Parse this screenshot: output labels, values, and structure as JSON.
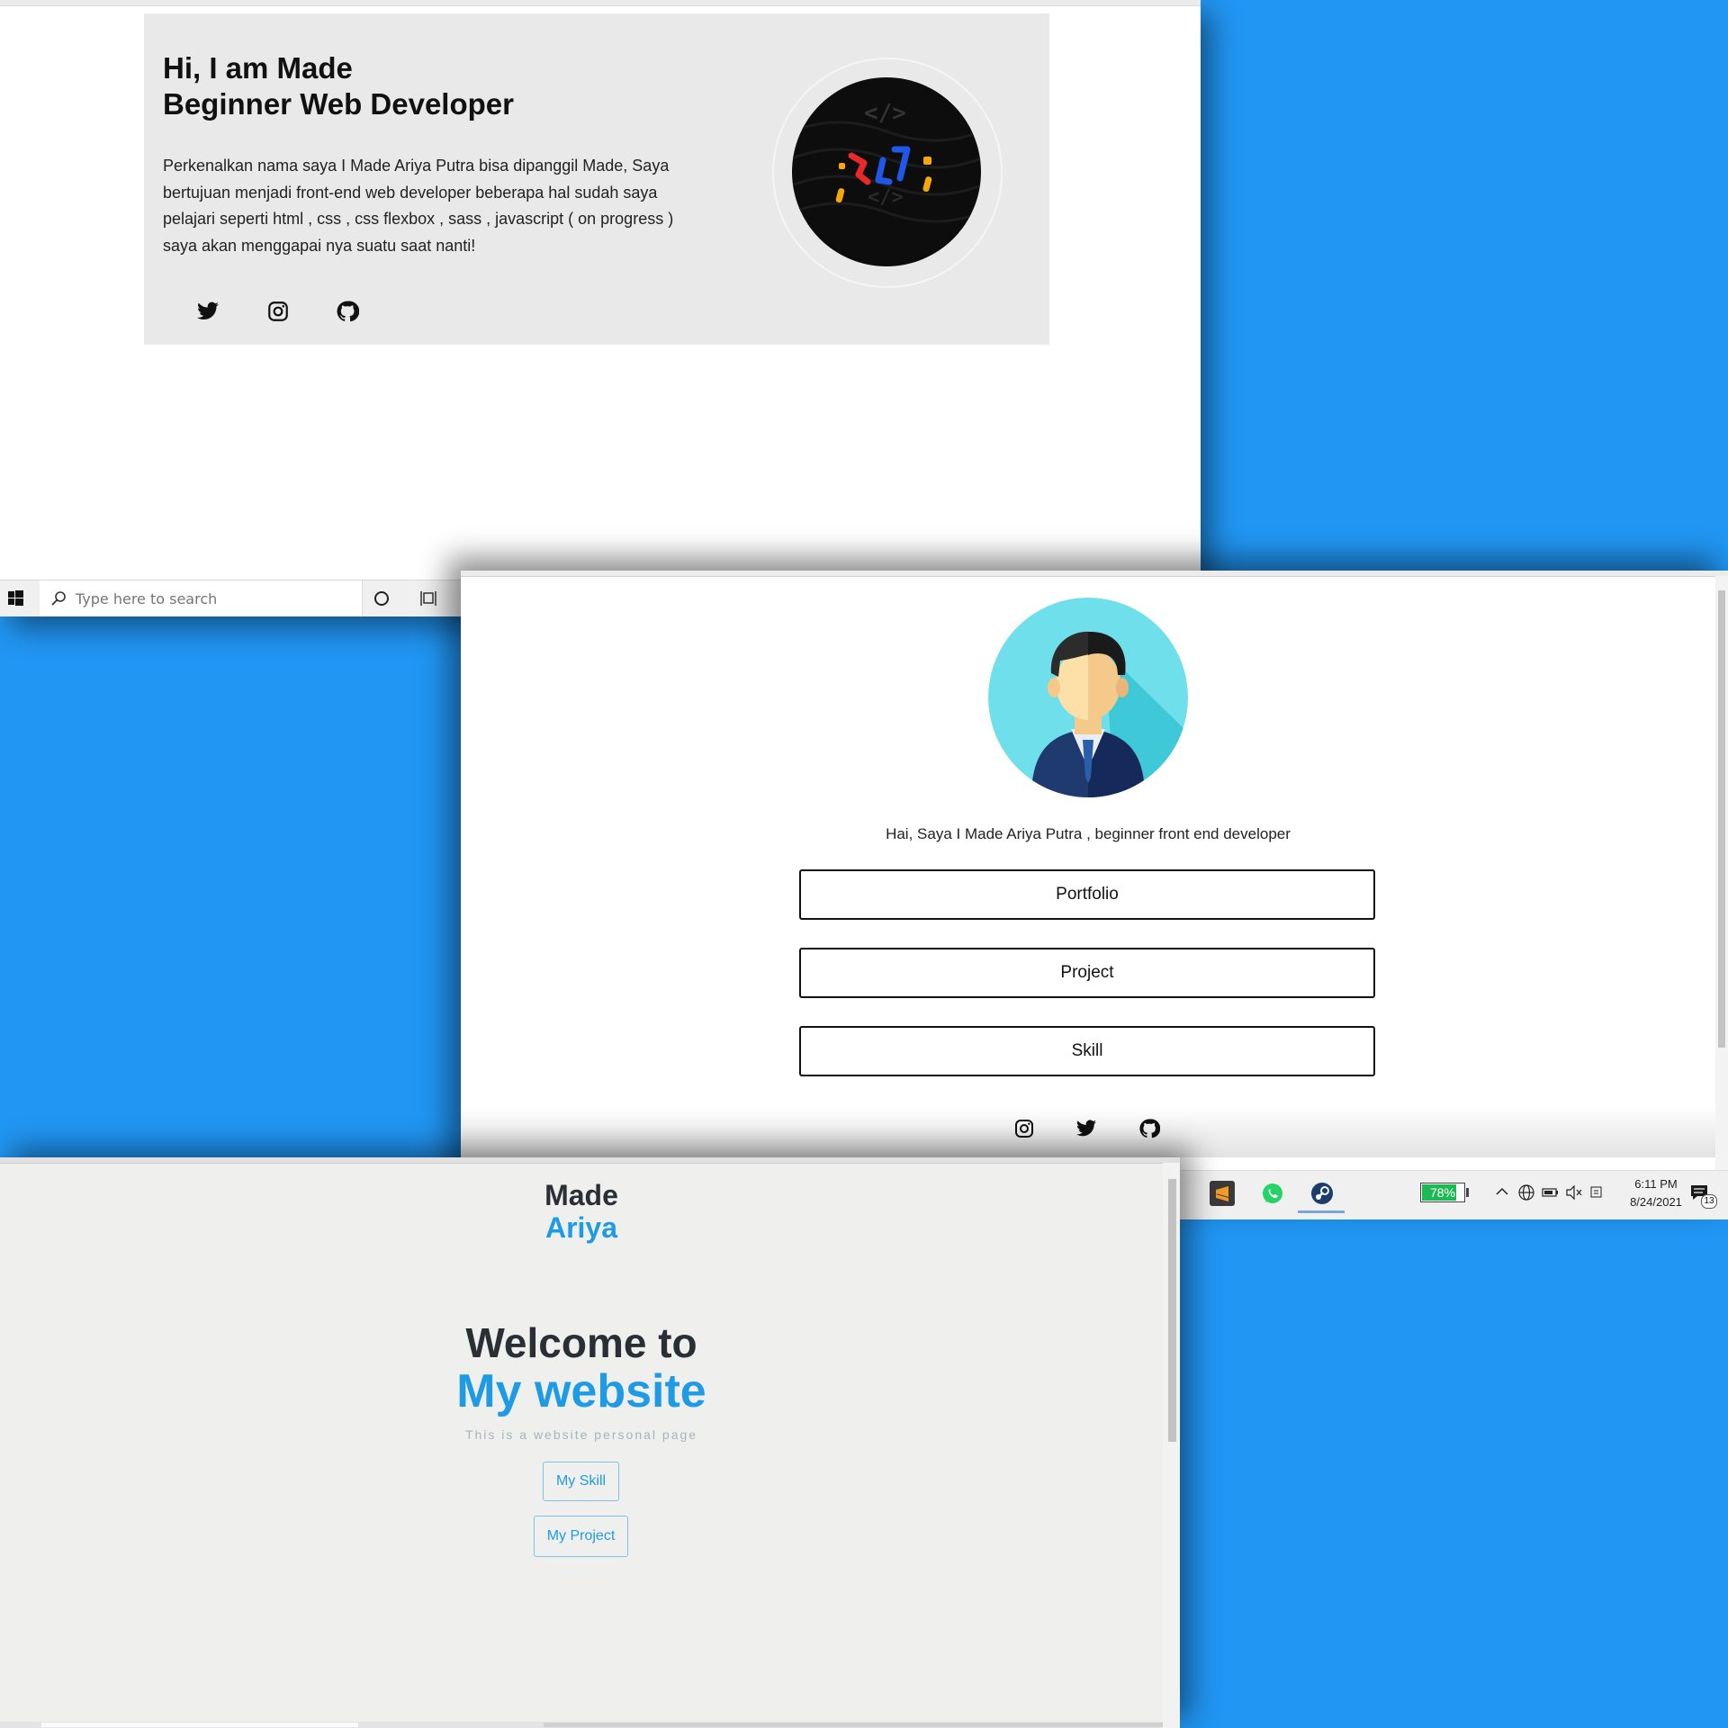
{
  "shot1": {
    "hero": {
      "title_line1": "Hi, I am Made",
      "title_line2": "Beginner Web Developer",
      "description": "Perkenalkan nama saya I Made Ariya Putra bisa dipanggil Made, Saya bertujuan menjadi front-end web developer beberapa hal sudah saya pelajari seperti html , css , css flexbox , sass , javascript ( on progress ) saya akan menggapai nya suatu saat nanti!",
      "social_icons": [
        "twitter-icon",
        "instagram-icon",
        "github-icon"
      ]
    },
    "taskbar": {
      "search_placeholder": "Type here to search"
    }
  },
  "shot2": {
    "intro": "Hai, Saya I Made Ariya Putra , beginner front end developer",
    "buttons": [
      "Portfolio",
      "Project",
      "Skill"
    ],
    "social_icons": [
      "instagram-icon",
      "twitter-icon",
      "github-icon"
    ],
    "taskbar": {
      "battery": "78%",
      "time": "6:11 PM",
      "date": "8/24/2021",
      "notification_count": "13",
      "apps": [
        "sublime-text-icon",
        "whatsapp-icon",
        "steam-icon"
      ]
    }
  },
  "shot3": {
    "brand_line1": "Made",
    "brand_line2": "Ariya",
    "welcome_line1": "Welcome to",
    "welcome_line2": "My website",
    "tagline": "This is a website personal page",
    "button_skill": "My Skill",
    "button_project": "My Project"
  },
  "colors": {
    "desktop_blue": "#2196f3",
    "brand_blue": "#1e9be4",
    "battery_green": "#1db954"
  }
}
